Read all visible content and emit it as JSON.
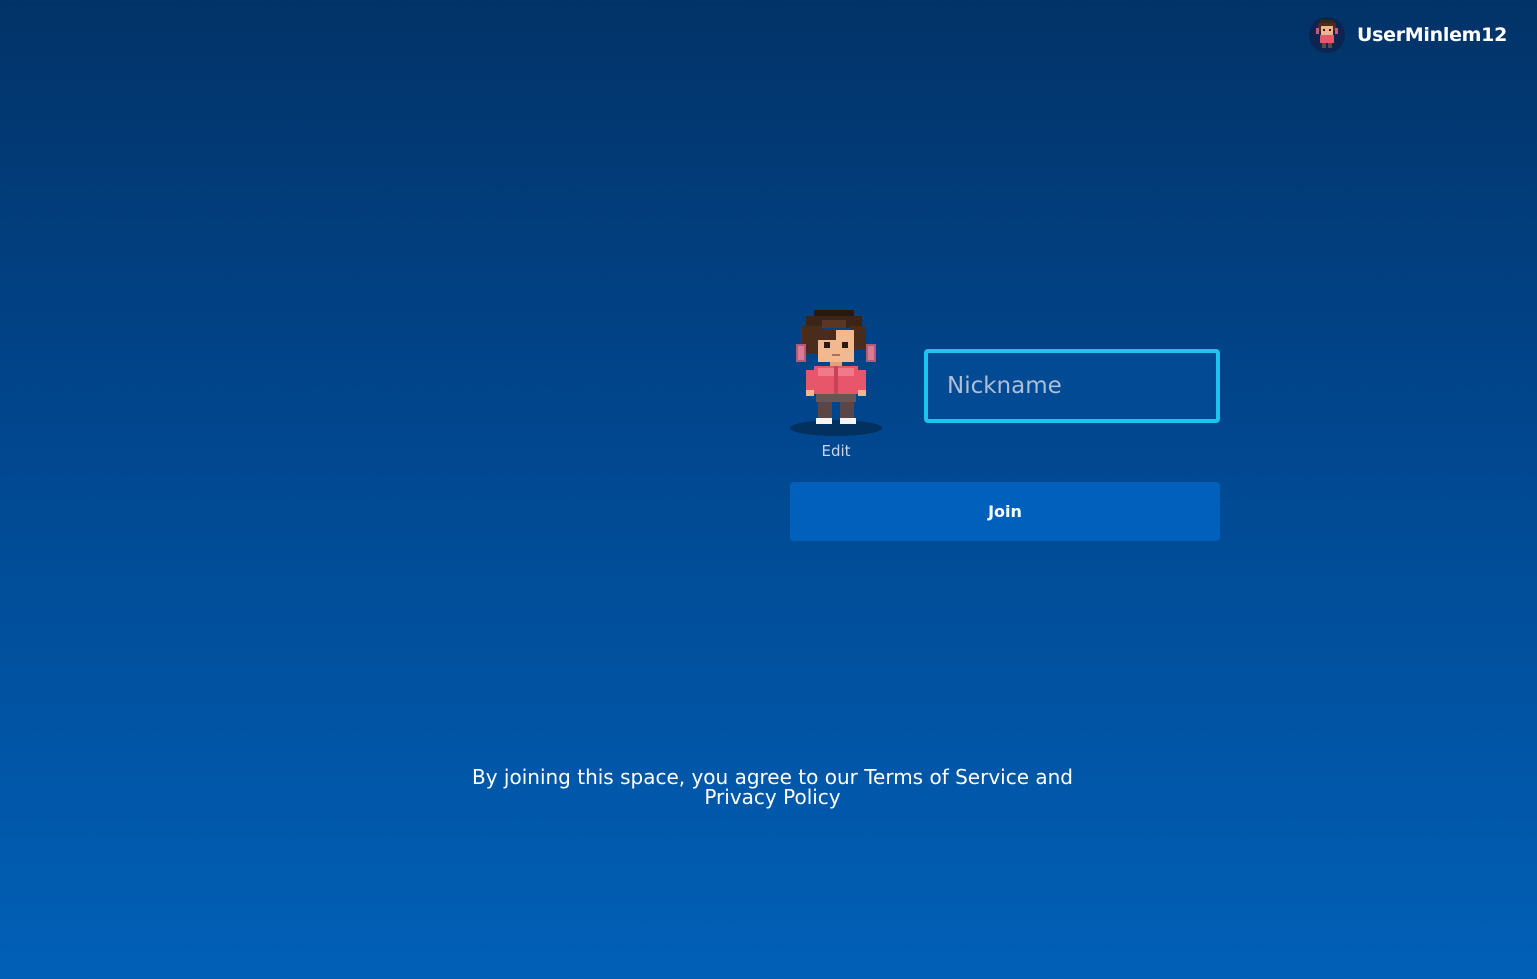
{
  "header": {
    "username": "UserMinlem12",
    "avatar_icon": "pixel-character-icon"
  },
  "join_form": {
    "edit_label": "Edit",
    "nickname_placeholder": "Nickname",
    "nickname_value": "",
    "join_label": "Join"
  },
  "legal": {
    "prefix": "By joining this space, you agree to our ",
    "terms_label": "Terms of Service",
    "conjunction": " and",
    "privacy_label": "Privacy Policy"
  },
  "colors": {
    "background_top": "#023368",
    "background_bottom": "#0160b7",
    "input_border": "#1ec3f0",
    "button": "#0260bd"
  }
}
